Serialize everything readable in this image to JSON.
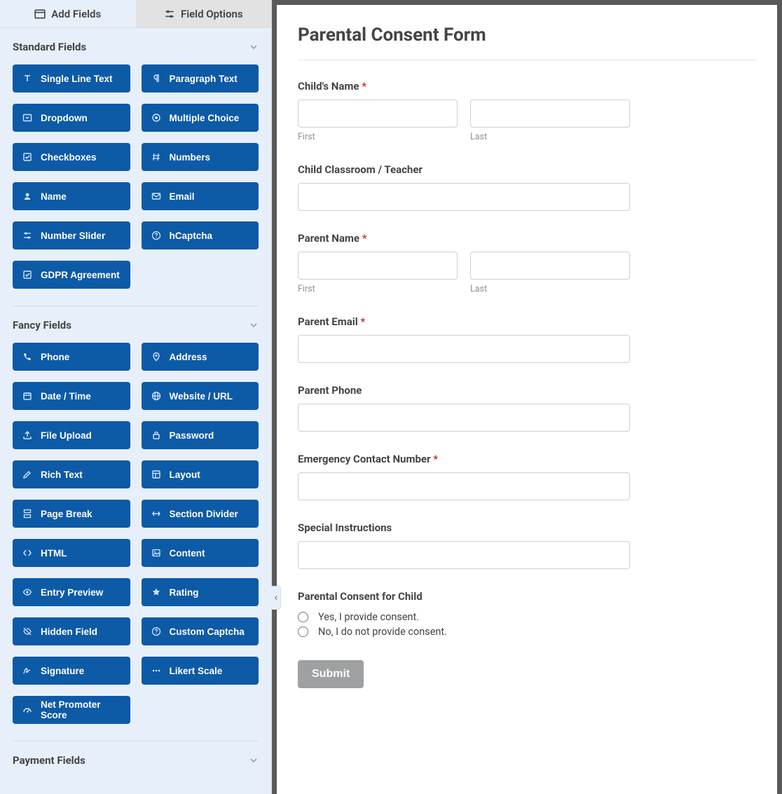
{
  "tabs": {
    "add_fields": "Add Fields",
    "field_options": "Field Options"
  },
  "sections": {
    "standard": {
      "title": "Standard Fields",
      "items": [
        {
          "icon": "text-icon",
          "label": "Single Line Text"
        },
        {
          "icon": "paragraph-icon",
          "label": "Paragraph Text"
        },
        {
          "icon": "dropdown-icon",
          "label": "Dropdown"
        },
        {
          "icon": "radio-icon",
          "label": "Multiple Choice"
        },
        {
          "icon": "checkboxes-icon",
          "label": "Checkboxes"
        },
        {
          "icon": "hash-icon",
          "label": "Numbers"
        },
        {
          "icon": "user-icon",
          "label": "Name"
        },
        {
          "icon": "mail-icon",
          "label": "Email"
        },
        {
          "icon": "sliders-icon",
          "label": "Number Slider"
        },
        {
          "icon": "question-icon",
          "label": "hCaptcha"
        },
        {
          "icon": "check-square-icon",
          "label": "GDPR Agreement"
        }
      ]
    },
    "fancy": {
      "title": "Fancy Fields",
      "items": [
        {
          "icon": "phone-icon",
          "label": "Phone"
        },
        {
          "icon": "map-pin-icon",
          "label": "Address"
        },
        {
          "icon": "calendar-icon",
          "label": "Date / Time"
        },
        {
          "icon": "globe-icon",
          "label": "Website / URL"
        },
        {
          "icon": "upload-icon",
          "label": "File Upload"
        },
        {
          "icon": "lock-icon",
          "label": "Password"
        },
        {
          "icon": "edit-icon",
          "label": "Rich Text"
        },
        {
          "icon": "layout-icon",
          "label": "Layout"
        },
        {
          "icon": "page-break-icon",
          "label": "Page Break"
        },
        {
          "icon": "divider-icon",
          "label": "Section Divider"
        },
        {
          "icon": "code-icon",
          "label": "HTML"
        },
        {
          "icon": "image-icon",
          "label": "Content"
        },
        {
          "icon": "eye-icon",
          "label": "Entry Preview"
        },
        {
          "icon": "star-icon",
          "label": "Rating"
        },
        {
          "icon": "eye-off-icon",
          "label": "Hidden Field"
        },
        {
          "icon": "question-icon",
          "label": "Custom Captcha"
        },
        {
          "icon": "signature-icon",
          "label": "Signature"
        },
        {
          "icon": "dots-icon",
          "label": "Likert Scale"
        },
        {
          "icon": "gauge-icon",
          "label": "Net Promoter Score"
        }
      ]
    },
    "payment": {
      "title": "Payment Fields"
    }
  },
  "form": {
    "title": "Parental Consent Form",
    "fields": {
      "child_name": {
        "label": "Child's Name",
        "required": true,
        "first": "First",
        "last": "Last"
      },
      "classroom": {
        "label": "Child Classroom / Teacher"
      },
      "parent_name": {
        "label": "Parent Name",
        "required": true,
        "first": "First",
        "last": "Last"
      },
      "parent_email": {
        "label": "Parent Email",
        "required": true
      },
      "parent_phone": {
        "label": "Parent Phone"
      },
      "emergency": {
        "label": "Emergency Contact Number",
        "required": true
      },
      "instructions": {
        "label": "Special Instructions"
      },
      "consent": {
        "label": "Parental Consent for Child",
        "options": [
          "Yes, I provide consent.",
          "No, I do not provide consent."
        ]
      }
    },
    "submit": "Submit"
  },
  "required_marker": "*"
}
